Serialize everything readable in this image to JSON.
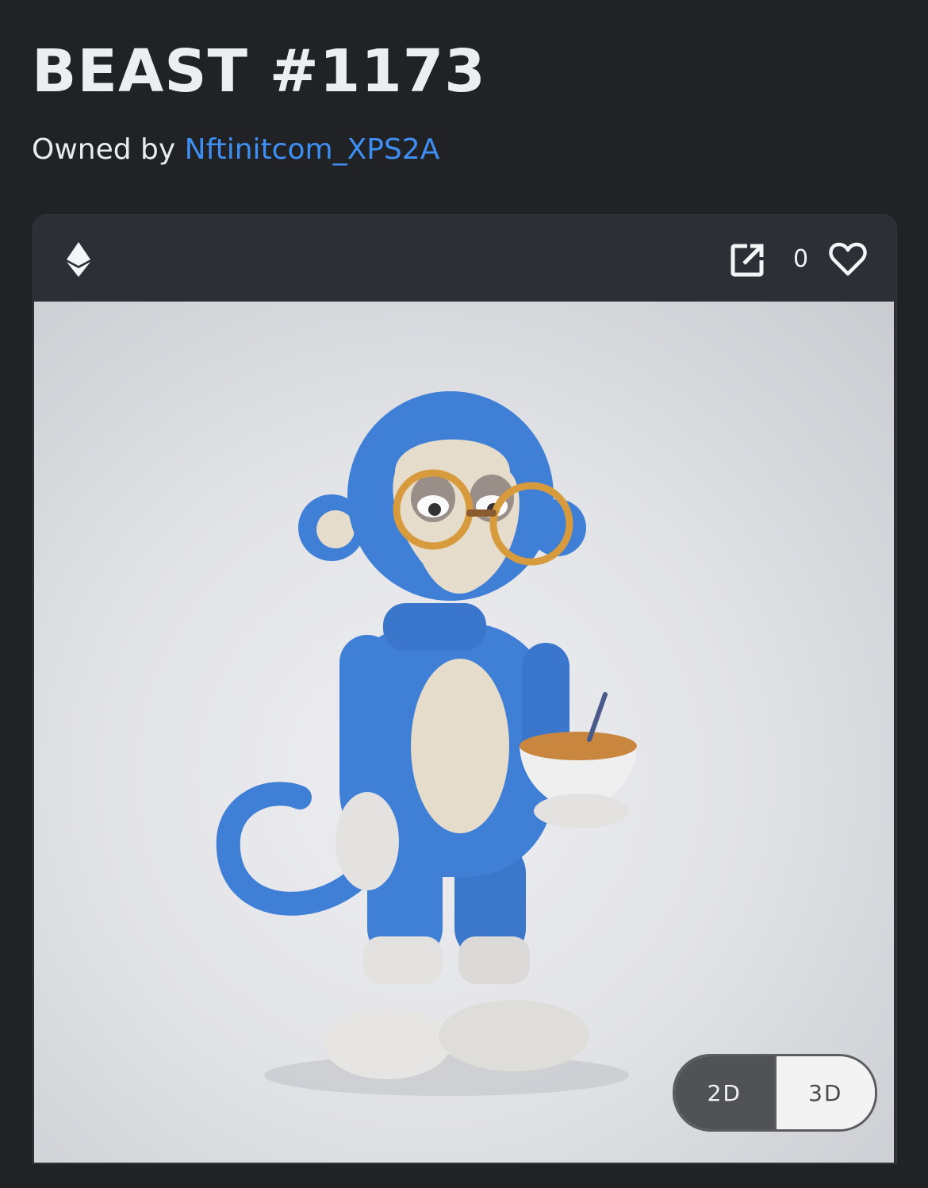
{
  "page": {
    "title": "BEAST #1173",
    "owner_prefix": "Owned by",
    "owner_name": "Nftinitcom_XPS2A"
  },
  "card": {
    "chain_icon": "ethereum-icon",
    "open_icon": "external-link-icon",
    "like_icon": "heart-icon",
    "like_count": "0"
  },
  "media": {
    "description_icon": "nft-artwork-blue-monkey",
    "view_modes": [
      "2D",
      "3D"
    ],
    "selected_mode": "2D"
  },
  "colors": {
    "background": "#202226",
    "card": "#2c2f35",
    "link": "#3f8ef2",
    "monkey_blue": "#3f7fd6",
    "toggle_active": "#505256"
  }
}
